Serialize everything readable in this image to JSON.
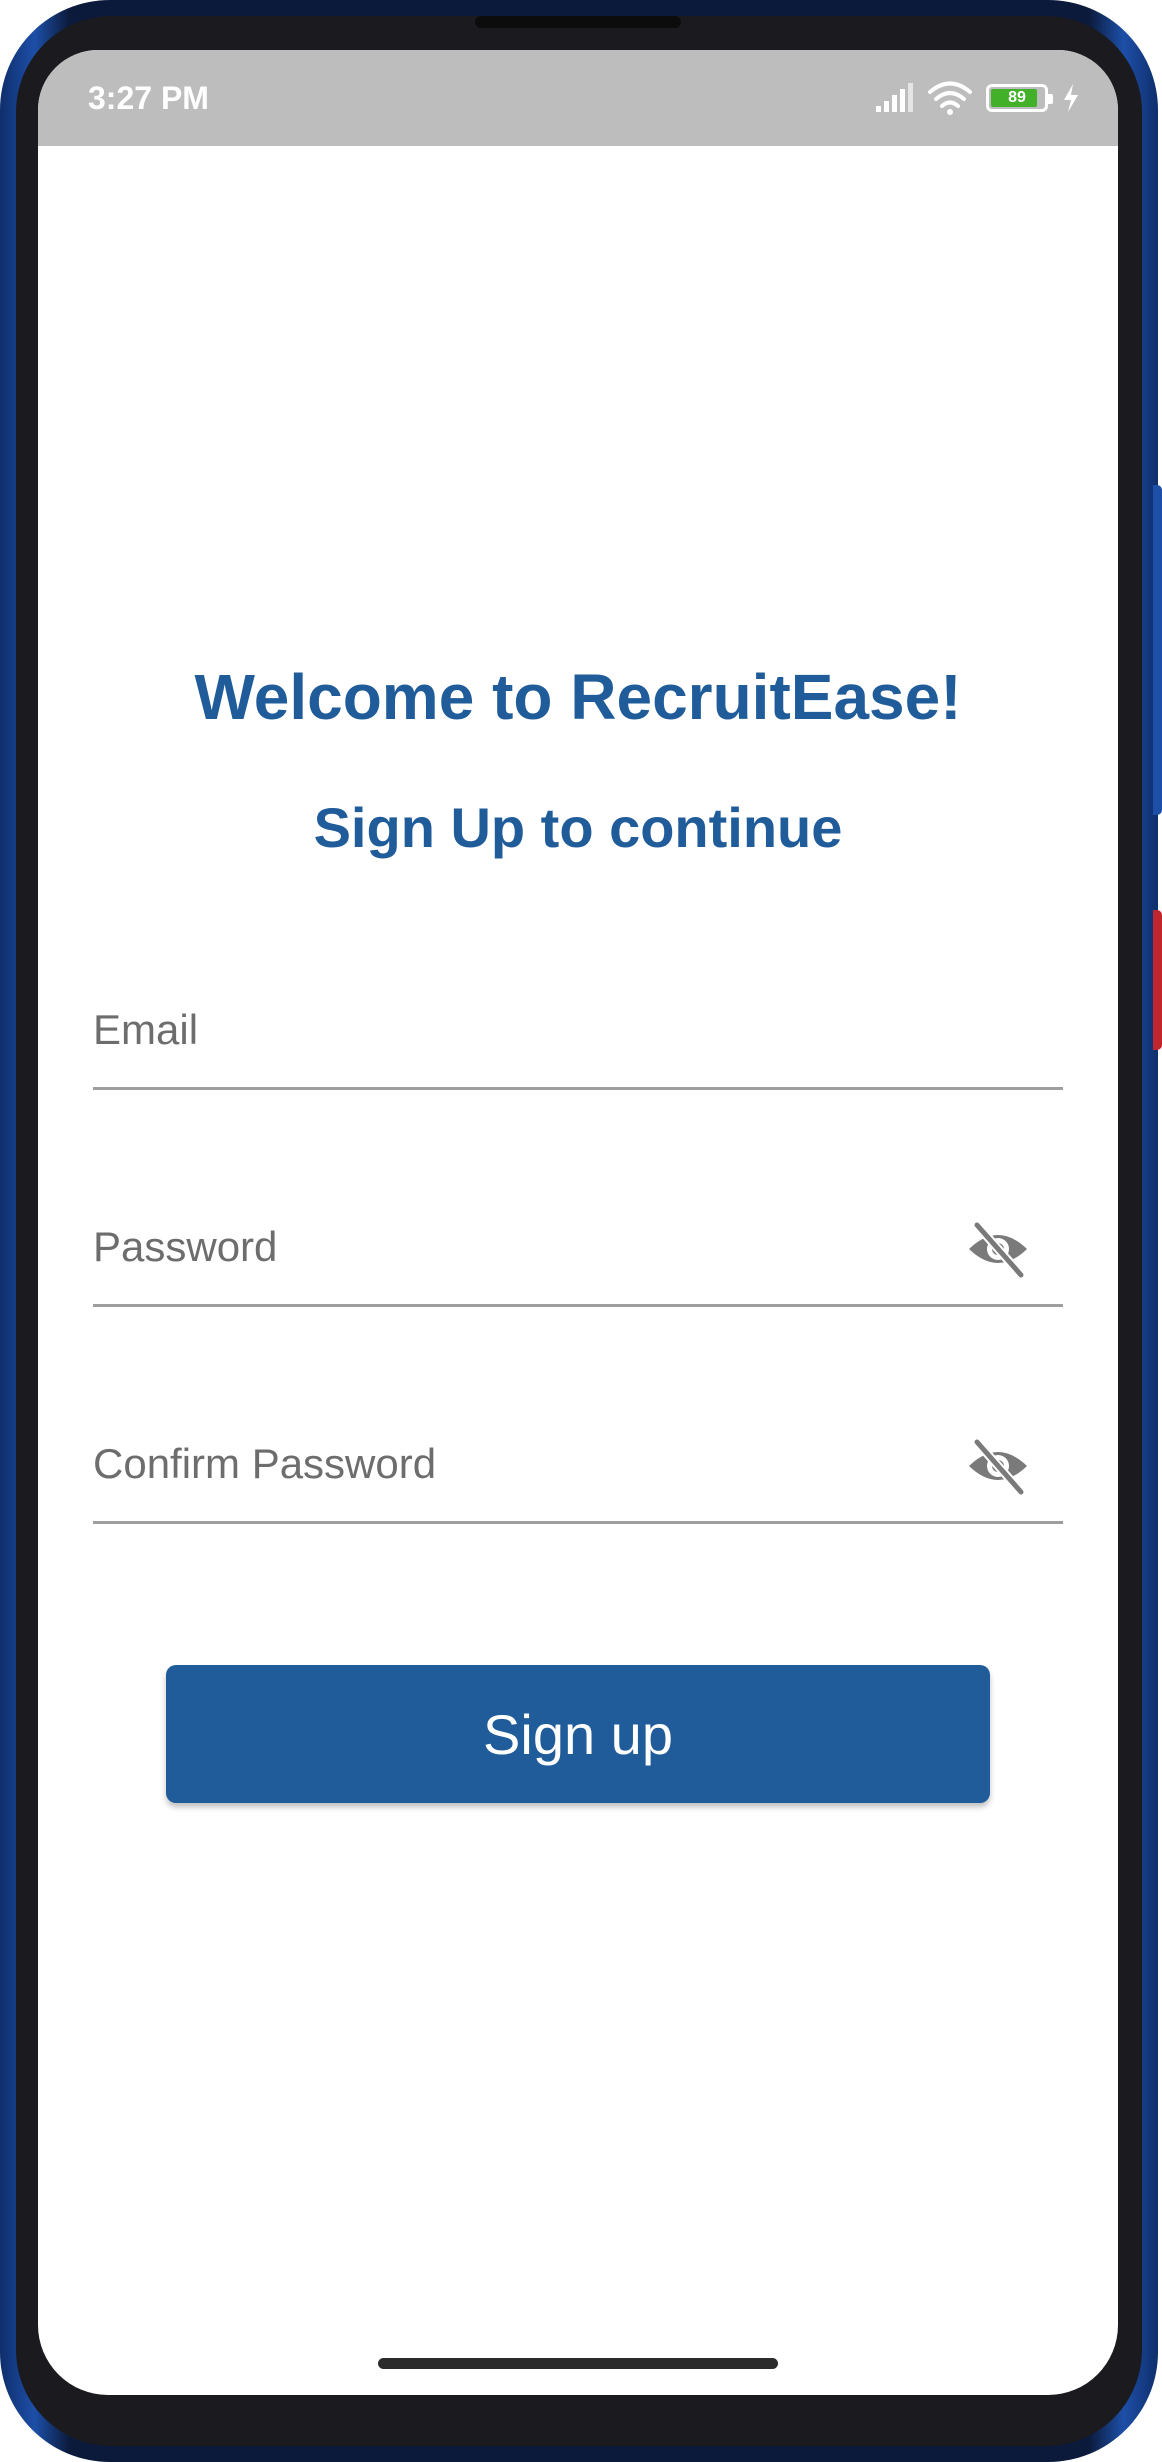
{
  "status_bar": {
    "time": "3:27 PM",
    "battery_level": "89",
    "battery_fraction": 0.89,
    "icons": [
      "signal-icon",
      "wifi-icon",
      "battery-icon",
      "charging-icon"
    ]
  },
  "header": {
    "title": "Welcome to RecruitEase!",
    "subtitle": "Sign Up to continue"
  },
  "form": {
    "email": {
      "placeholder": "Email",
      "value": ""
    },
    "password": {
      "placeholder": "Password",
      "value": "",
      "toggle_icon": "eye-off-icon"
    },
    "confirm_password": {
      "placeholder": "Confirm Password",
      "value": "",
      "toggle_icon": "eye-off-icon"
    },
    "submit_label": "Sign up"
  },
  "colors": {
    "primary": "#1f5c99",
    "status_bar": "#bdbdbd",
    "underline": "#9e9e9e",
    "battery_green": "#43b02a"
  }
}
